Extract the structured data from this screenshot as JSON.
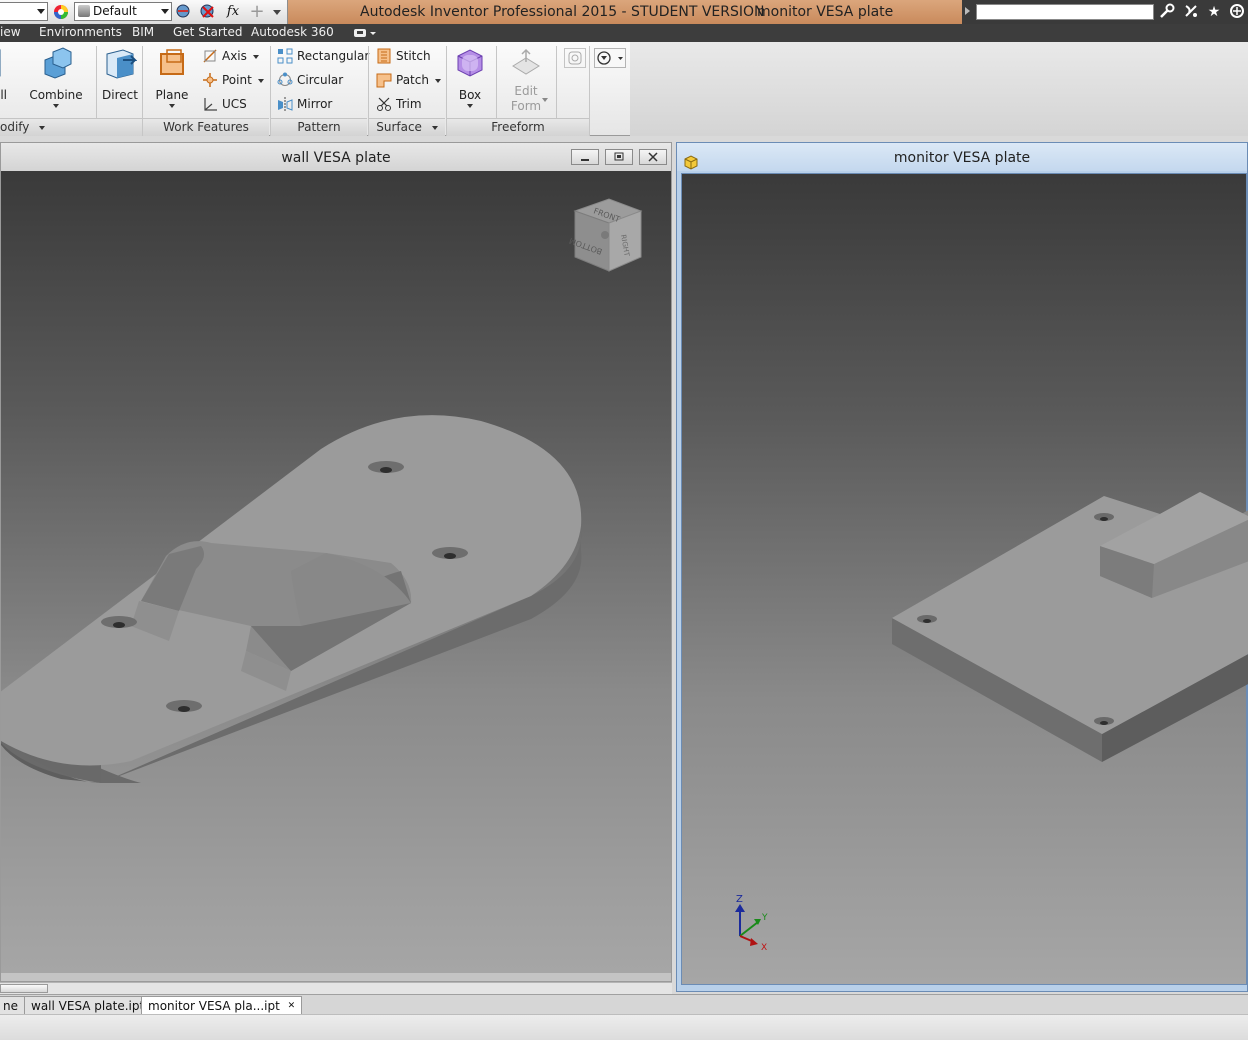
{
  "quick_access": {
    "appearance_value": "Default",
    "fx_label": "fx"
  },
  "title_bar": {
    "app_title": "Autodesk Inventor Professional 2015 - STUDENT VERSION",
    "document_title": "monitor VESA plate",
    "search_placeholder": ""
  },
  "ribbon_tabs": [
    {
      "label": "iew"
    },
    {
      "label": "Environments"
    },
    {
      "label": "BIM"
    },
    {
      "label": "Get Started"
    },
    {
      "label": "Autodesk 360"
    }
  ],
  "ribbon": {
    "modify": {
      "shell_label": "ell",
      "combine_label": "Combine",
      "direct_label": "Direct",
      "panel_label": "odify"
    },
    "work_features": {
      "plane_label": "Plane",
      "axis_label": "Axis",
      "point_label": "Point",
      "ucs_label": "UCS",
      "panel_label": "Work Features"
    },
    "pattern": {
      "rectangular_label": "Rectangular",
      "circular_label": "Circular",
      "mirror_label": "Mirror",
      "panel_label": "Pattern"
    },
    "surface": {
      "stitch_label": "Stitch",
      "patch_label": "Patch",
      "trim_label": "Trim",
      "panel_label": "Surface"
    },
    "freeform": {
      "box_label": "Box",
      "edit_label": "Edit",
      "form_label": "Form",
      "panel_label": "Freeform"
    }
  },
  "windows": {
    "left": {
      "title": "wall VESA plate",
      "viewcube": {
        "top": "FRONT",
        "right": "RIGHT",
        "front": "BOTTOM"
      }
    },
    "right": {
      "title": "monitor VESA plate",
      "triad": {
        "z": "Z",
        "y": "Y",
        "x": "X"
      }
    }
  },
  "doc_tabs": [
    {
      "label": "ne",
      "active": false
    },
    {
      "label": "wall VESA plate.ipt",
      "active": false
    },
    {
      "label": "monitor VESA pla...ipt",
      "active": true
    }
  ],
  "colors": {
    "title_accent": "#d49a6e",
    "active_window_border": "#6b8cb5",
    "model_gray": "#9a9a9a"
  }
}
